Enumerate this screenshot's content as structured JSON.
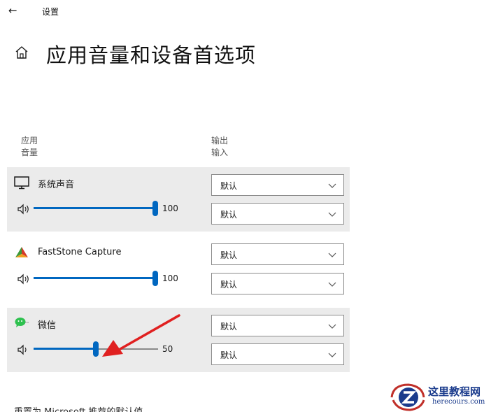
{
  "window": {
    "title": "设置"
  },
  "page": {
    "title": "应用音量和设备首选项"
  },
  "columns": {
    "left": {
      "line1": "应用",
      "line2": "音量"
    },
    "right": {
      "line1": "输出",
      "line2": "输入"
    }
  },
  "apps": [
    {
      "name": "系统声音",
      "volume": 100,
      "volume_label": "100",
      "output": "默认",
      "input": "默认",
      "icon": "monitor-icon"
    },
    {
      "name": "FastStone Capture",
      "volume": 100,
      "volume_label": "100",
      "output": "默认",
      "input": "默认",
      "icon": "faststone-icon"
    },
    {
      "name": "微信",
      "volume": 50,
      "volume_label": "50",
      "output": "默认",
      "input": "默认",
      "icon": "wechat-icon"
    }
  ],
  "reset": {
    "label": "重置为 Microsoft 推荐的默认值"
  },
  "watermark": {
    "line1": "这里教程网",
    "line2": "herecours.com"
  },
  "colors": {
    "accent": "#0067c0",
    "panel_bg": "#ebebeb",
    "annotation": "#e02020"
  }
}
